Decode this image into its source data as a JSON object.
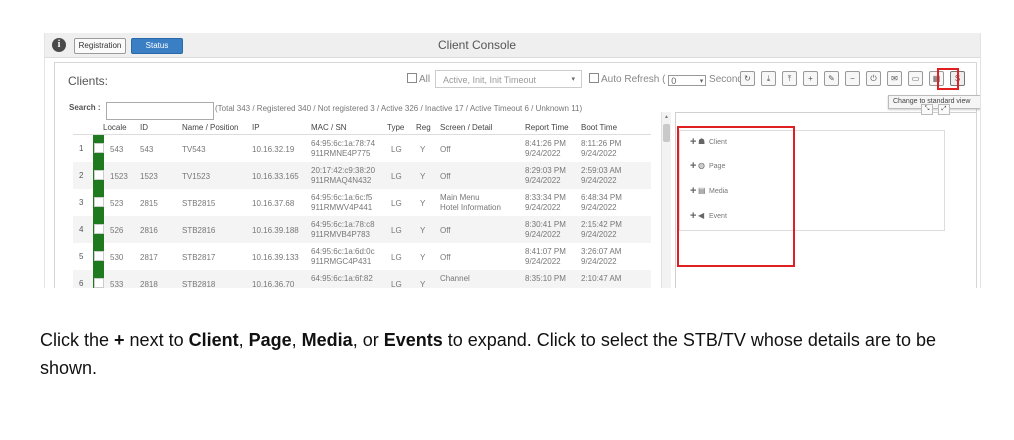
{
  "header": {
    "info_icon": "info-icon",
    "registration_label": "Registration",
    "status_label": "Status",
    "title": "Client Console"
  },
  "toolbar": {
    "clients_label": "Clients:",
    "all_label": "All",
    "filter_value": "Active, Init, Init Timeout",
    "auto_refresh_label": "Auto Refresh (",
    "refresh_value": "0",
    "seconds_label": "Seconds)",
    "standard_view_glyph": "S",
    "tooltip": "Change to standard view"
  },
  "search": {
    "label": "Search :",
    "placeholder": "",
    "totals": "(Total 343 / Registered 340 / Not registered 3 / Active 326 / Inactive 17 / Active Timeout 6 / Unknown 11)"
  },
  "table": {
    "columns": [
      "Locale",
      "ID",
      "Name / Position",
      "IP",
      "MAC / SN",
      "Type",
      "Reg",
      "Screen / Detail",
      "Report Time",
      "Boot Time"
    ],
    "rows": [
      {
        "n": "1",
        "locale": "543",
        "id": "543",
        "name": "TV543",
        "ip": "10.16.32.19",
        "mac": "64:95:6c:1a:78:74",
        "sn": "911RMNE4P775",
        "type": "LG",
        "reg": "Y",
        "screen": "Off",
        "screen2": "",
        "report": "8:41:26 PM",
        "report_date": "9/24/2022",
        "boot": "8:11:26 PM",
        "boot_date": "9/24/2022"
      },
      {
        "n": "2",
        "locale": "1523",
        "id": "1523",
        "name": "TV1523",
        "ip": "10.16.33.165",
        "mac": "20:17:42:c9:38:20",
        "sn": "911RMAQ4N432",
        "type": "LG",
        "reg": "Y",
        "screen": "Off",
        "screen2": "",
        "report": "8:29:03 PM",
        "report_date": "9/24/2022",
        "boot": "2:59:03 AM",
        "boot_date": "9/24/2022"
      },
      {
        "n": "3",
        "locale": "523",
        "id": "2815",
        "name": "STB2815",
        "ip": "10.16.37.68",
        "mac": "64:95:6c:1a:6c:f5",
        "sn": "911RMWV4P441",
        "type": "LG",
        "reg": "Y",
        "screen": "Main Menu",
        "screen2": "Hotel Information",
        "report": "8:33:34 PM",
        "report_date": "9/24/2022",
        "boot": "6:48:34 PM",
        "boot_date": "9/24/2022"
      },
      {
        "n": "4",
        "locale": "526",
        "id": "2816",
        "name": "STB2816",
        "ip": "10.16.39.188",
        "mac": "64:95:6c:1a:78:c8",
        "sn": "911RMVB4P783",
        "type": "LG",
        "reg": "Y",
        "screen": "Off",
        "screen2": "",
        "report": "8:30:41 PM",
        "report_date": "9/24/2022",
        "boot": "2:15:42 PM",
        "boot_date": "9/24/2022"
      },
      {
        "n": "5",
        "locale": "530",
        "id": "2817",
        "name": "STB2817",
        "ip": "10.16.39.133",
        "mac": "64:95:6c:1a:6d:0c",
        "sn": "911RMGC4P431",
        "type": "LG",
        "reg": "Y",
        "screen": "Off",
        "screen2": "",
        "report": "8:41:07 PM",
        "report_date": "9/24/2022",
        "boot": "3:26:07 AM",
        "boot_date": "9/24/2022"
      },
      {
        "n": "6",
        "locale": "533",
        "id": "2818",
        "name": "STB2818",
        "ip": "10.16.36.70",
        "mac": "64:95:6c:1a:6f:82",
        "sn": "",
        "type": "LG",
        "reg": "Y",
        "screen": "Channel",
        "screen2": "",
        "report": "8:35:10 PM",
        "report_date": "",
        "boot": "2:10:47 AM",
        "boot_date": ""
      }
    ]
  },
  "details": [
    {
      "label": "Client",
      "icon": "client-icon",
      "glyph": "☗"
    },
    {
      "label": "Page",
      "icon": "globe-icon",
      "glyph": "◍"
    },
    {
      "label": "Media",
      "icon": "film-icon",
      "glyph": "▤"
    },
    {
      "label": "Event",
      "icon": "bullhorn-icon",
      "glyph": "◀"
    }
  ],
  "caption": {
    "p1": "Click the ",
    "plus": "+",
    "p2": " next to ",
    "client": "Client",
    "c1": ", ",
    "page": "Page",
    "c2": ", ",
    "media": "Media",
    "c3": ", or ",
    "events": "Events",
    "p3": " to expand. Click to select the STB/TV whose details are to be shown."
  },
  "colors": {
    "status_button": "#3a7fc4",
    "row_indicator": "#1f7a1f",
    "highlight": "#e02020"
  }
}
